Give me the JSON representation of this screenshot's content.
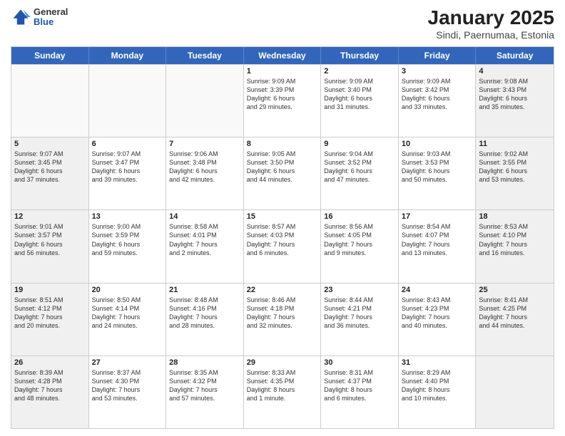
{
  "header": {
    "logo": {
      "general": "General",
      "blue": "Blue"
    },
    "title": "January 2025",
    "subtitle": "Sindi, Paernumaa, Estonia"
  },
  "weekdays": [
    "Sunday",
    "Monday",
    "Tuesday",
    "Wednesday",
    "Thursday",
    "Friday",
    "Saturday"
  ],
  "rows": [
    [
      {
        "day": "",
        "text": "",
        "shaded": false,
        "empty": true
      },
      {
        "day": "",
        "text": "",
        "shaded": false,
        "empty": true
      },
      {
        "day": "",
        "text": "",
        "shaded": false,
        "empty": true
      },
      {
        "day": "1",
        "text": "Sunrise: 9:09 AM\nSunset: 3:39 PM\nDaylight: 6 hours\nand 29 minutes.",
        "shaded": false,
        "empty": false
      },
      {
        "day": "2",
        "text": "Sunrise: 9:09 AM\nSunset: 3:40 PM\nDaylight: 6 hours\nand 31 minutes.",
        "shaded": false,
        "empty": false
      },
      {
        "day": "3",
        "text": "Sunrise: 9:09 AM\nSunset: 3:42 PM\nDaylight: 6 hours\nand 33 minutes.",
        "shaded": false,
        "empty": false
      },
      {
        "day": "4",
        "text": "Sunrise: 9:08 AM\nSunset: 3:43 PM\nDaylight: 6 hours\nand 35 minutes.",
        "shaded": true,
        "empty": false
      }
    ],
    [
      {
        "day": "5",
        "text": "Sunrise: 9:07 AM\nSunset: 3:45 PM\nDaylight: 6 hours\nand 37 minutes.",
        "shaded": true,
        "empty": false
      },
      {
        "day": "6",
        "text": "Sunrise: 9:07 AM\nSunset: 3:47 PM\nDaylight: 6 hours\nand 39 minutes.",
        "shaded": false,
        "empty": false
      },
      {
        "day": "7",
        "text": "Sunrise: 9:06 AM\nSunset: 3:48 PM\nDaylight: 6 hours\nand 42 minutes.",
        "shaded": false,
        "empty": false
      },
      {
        "day": "8",
        "text": "Sunrise: 9:05 AM\nSunset: 3:50 PM\nDaylight: 6 hours\nand 44 minutes.",
        "shaded": false,
        "empty": false
      },
      {
        "day": "9",
        "text": "Sunrise: 9:04 AM\nSunset: 3:52 PM\nDaylight: 6 hours\nand 47 minutes.",
        "shaded": false,
        "empty": false
      },
      {
        "day": "10",
        "text": "Sunrise: 9:03 AM\nSunset: 3:53 PM\nDaylight: 6 hours\nand 50 minutes.",
        "shaded": false,
        "empty": false
      },
      {
        "day": "11",
        "text": "Sunrise: 9:02 AM\nSunset: 3:55 PM\nDaylight: 6 hours\nand 53 minutes.",
        "shaded": true,
        "empty": false
      }
    ],
    [
      {
        "day": "12",
        "text": "Sunrise: 9:01 AM\nSunset: 3:57 PM\nDaylight: 6 hours\nand 56 minutes.",
        "shaded": true,
        "empty": false
      },
      {
        "day": "13",
        "text": "Sunrise: 9:00 AM\nSunset: 3:59 PM\nDaylight: 6 hours\nand 59 minutes.",
        "shaded": false,
        "empty": false
      },
      {
        "day": "14",
        "text": "Sunrise: 8:58 AM\nSunset: 4:01 PM\nDaylight: 7 hours\nand 2 minutes.",
        "shaded": false,
        "empty": false
      },
      {
        "day": "15",
        "text": "Sunrise: 8:57 AM\nSunset: 4:03 PM\nDaylight: 7 hours\nand 6 minutes.",
        "shaded": false,
        "empty": false
      },
      {
        "day": "16",
        "text": "Sunrise: 8:56 AM\nSunset: 4:05 PM\nDaylight: 7 hours\nand 9 minutes.",
        "shaded": false,
        "empty": false
      },
      {
        "day": "17",
        "text": "Sunrise: 8:54 AM\nSunset: 4:07 PM\nDaylight: 7 hours\nand 13 minutes.",
        "shaded": false,
        "empty": false
      },
      {
        "day": "18",
        "text": "Sunrise: 8:53 AM\nSunset: 4:10 PM\nDaylight: 7 hours\nand 16 minutes.",
        "shaded": true,
        "empty": false
      }
    ],
    [
      {
        "day": "19",
        "text": "Sunrise: 8:51 AM\nSunset: 4:12 PM\nDaylight: 7 hours\nand 20 minutes.",
        "shaded": true,
        "empty": false
      },
      {
        "day": "20",
        "text": "Sunrise: 8:50 AM\nSunset: 4:14 PM\nDaylight: 7 hours\nand 24 minutes.",
        "shaded": false,
        "empty": false
      },
      {
        "day": "21",
        "text": "Sunrise: 8:48 AM\nSunset: 4:16 PM\nDaylight: 7 hours\nand 28 minutes.",
        "shaded": false,
        "empty": false
      },
      {
        "day": "22",
        "text": "Sunrise: 8:46 AM\nSunset: 4:18 PM\nDaylight: 7 hours\nand 32 minutes.",
        "shaded": false,
        "empty": false
      },
      {
        "day": "23",
        "text": "Sunrise: 8:44 AM\nSunset: 4:21 PM\nDaylight: 7 hours\nand 36 minutes.",
        "shaded": false,
        "empty": false
      },
      {
        "day": "24",
        "text": "Sunrise: 8:43 AM\nSunset: 4:23 PM\nDaylight: 7 hours\nand 40 minutes.",
        "shaded": false,
        "empty": false
      },
      {
        "day": "25",
        "text": "Sunrise: 8:41 AM\nSunset: 4:25 PM\nDaylight: 7 hours\nand 44 minutes.",
        "shaded": true,
        "empty": false
      }
    ],
    [
      {
        "day": "26",
        "text": "Sunrise: 8:39 AM\nSunset: 4:28 PM\nDaylight: 7 hours\nand 48 minutes.",
        "shaded": true,
        "empty": false
      },
      {
        "day": "27",
        "text": "Sunrise: 8:37 AM\nSunset: 4:30 PM\nDaylight: 7 hours\nand 53 minutes.",
        "shaded": false,
        "empty": false
      },
      {
        "day": "28",
        "text": "Sunrise: 8:35 AM\nSunset: 4:32 PM\nDaylight: 7 hours\nand 57 minutes.",
        "shaded": false,
        "empty": false
      },
      {
        "day": "29",
        "text": "Sunrise: 8:33 AM\nSunset: 4:35 PM\nDaylight: 8 hours\nand 1 minute.",
        "shaded": false,
        "empty": false
      },
      {
        "day": "30",
        "text": "Sunrise: 8:31 AM\nSunset: 4:37 PM\nDaylight: 8 hours\nand 6 minutes.",
        "shaded": false,
        "empty": false
      },
      {
        "day": "31",
        "text": "Sunrise: 8:29 AM\nSunset: 4:40 PM\nDaylight: 8 hours\nand 10 minutes.",
        "shaded": false,
        "empty": false
      },
      {
        "day": "",
        "text": "",
        "shaded": true,
        "empty": true
      }
    ]
  ]
}
